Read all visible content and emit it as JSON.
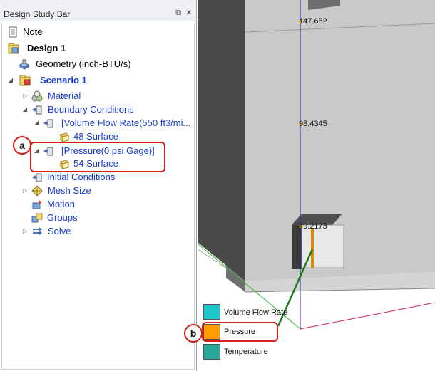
{
  "panel": {
    "title": "Design Study Bar",
    "pin_glyph": "⧉",
    "close_glyph": "×"
  },
  "tree": {
    "note": "Note",
    "design": "Design 1",
    "geometry": "Geometry (inch-BTU/s)",
    "scenario": "Scenario 1",
    "material": "Material",
    "boundary_conditions": "Boundary Conditions",
    "volume_flow_rate": "[Volume Flow Rate(550 ft3/mi...",
    "volume_flow_surface": "48 Surface",
    "pressure": "[Pressure(0 psi Gage)]",
    "pressure_surface": "54 Surface",
    "initial_conditions": "Initial Conditions",
    "mesh_size": "Mesh Size",
    "motion": "Motion",
    "groups": "Groups",
    "solve": "Solve"
  },
  "viewport": {
    "coord_top": "147.652",
    "coord_mid": "98.4345",
    "coord_low": "49.2173",
    "legend": [
      {
        "label": "Volume Flow Rate",
        "color": "#1fc9c9"
      },
      {
        "label": "Pressure",
        "color": "#ff9c00"
      },
      {
        "label": "Temperature",
        "color": "#2aa89a"
      }
    ]
  },
  "callouts": {
    "a": "a",
    "b": "b"
  },
  "colors": {
    "callout_red": "#d91c1c",
    "link_blue": "#1a3bd1",
    "leader_green": "#1c7a1c"
  }
}
